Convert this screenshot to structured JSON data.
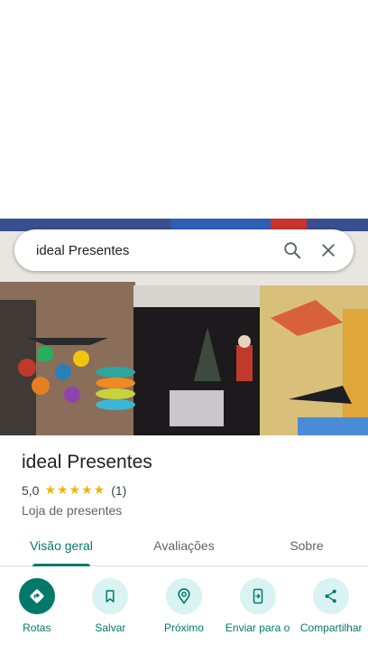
{
  "search": {
    "query": "ideal Presentes"
  },
  "place": {
    "title": "ideal Presentes",
    "rating": "5,0",
    "stars": "★★★★★",
    "review_count": "(1)",
    "category": "Loja de presentes"
  },
  "tabs": [
    {
      "label": "Visão geral",
      "active": true
    },
    {
      "label": "Avaliações",
      "active": false
    },
    {
      "label": "Sobre",
      "active": false
    }
  ],
  "actions": [
    {
      "label": "Rotas",
      "icon": "directions-icon"
    },
    {
      "label": "Salvar",
      "icon": "bookmark-icon"
    },
    {
      "label": "Próximo",
      "icon": "nearby-icon"
    },
    {
      "label": "Enviar para o",
      "icon": "send-to-phone-icon"
    },
    {
      "label": "Compartilhar",
      "icon": "share-icon"
    }
  ],
  "colors": {
    "accent": "#00796b",
    "accent_light": "#d8f3f1",
    "star": "#f4b400"
  }
}
